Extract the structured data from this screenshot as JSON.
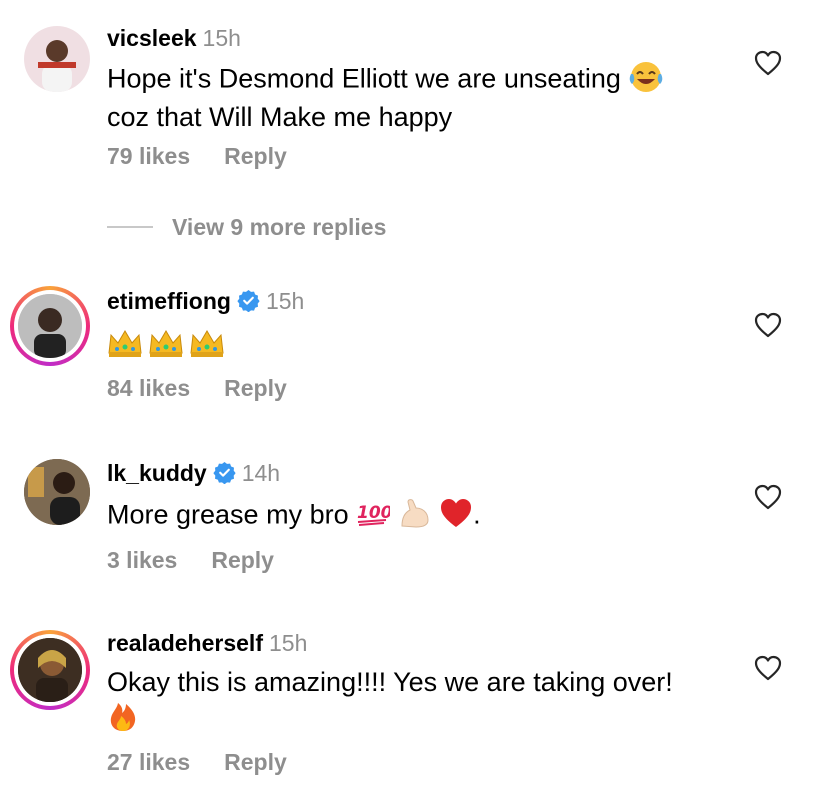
{
  "comments": [
    {
      "username": "vicsleek",
      "time": "15h",
      "text": "Hope it's Desmond Elliott we are unseating",
      "text2": "coz that Will Make me happy",
      "likes": "79 likes",
      "reply": "Reply",
      "view_more": "View 9 more replies",
      "emoji": "laughing-crying-emoji"
    },
    {
      "username": "etimeffiong",
      "time": "15h",
      "verified": true,
      "emoji": "crown-emoji",
      "likes": "84 likes",
      "reply": "Reply"
    },
    {
      "username": "lk_kuddy",
      "time": "14h",
      "verified": true,
      "text": "More grease my bro",
      "text_end": ".",
      "likes": "3 likes",
      "reply": "Reply"
    },
    {
      "username": "realadeherself",
      "time": "15h",
      "text": "Okay this is amazing!!!! Yes we are taking over!",
      "emoji": "fire-emoji",
      "likes": "27 likes",
      "reply": "Reply"
    }
  ],
  "colors": {
    "muted": "#8e8e8e",
    "verified": "#3897f0",
    "story_ring": "#ee2a7b"
  }
}
